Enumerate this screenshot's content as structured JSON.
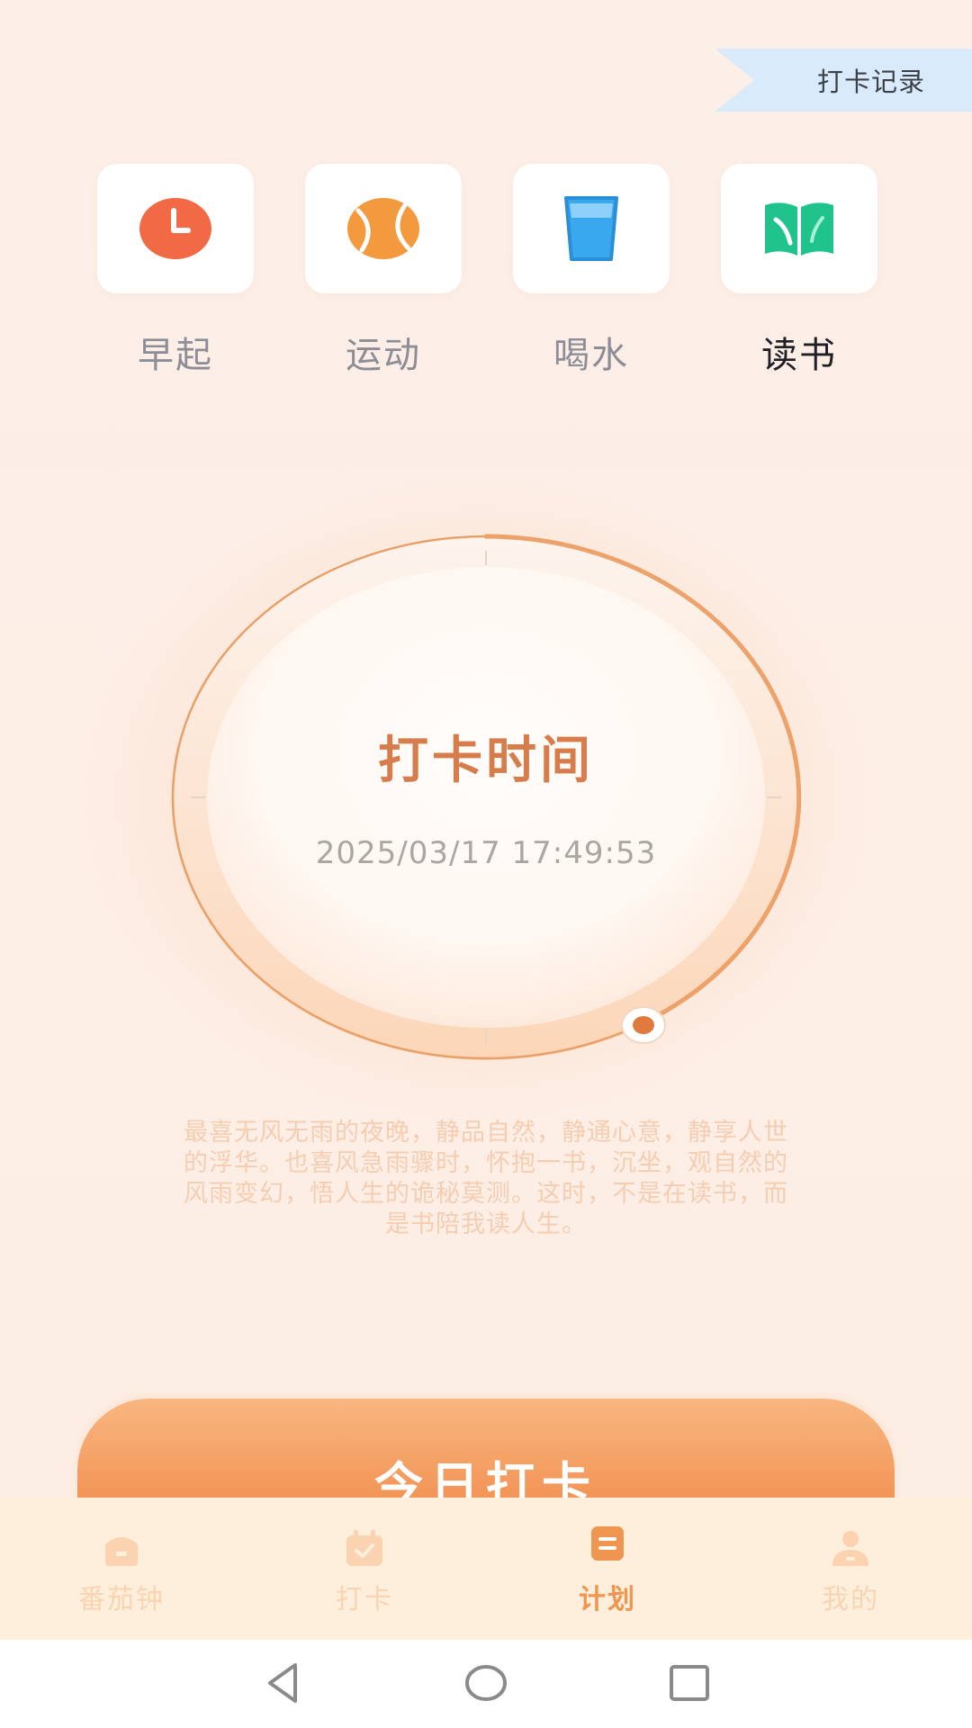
{
  "header": {
    "record_label": "打卡记录"
  },
  "categories": [
    {
      "label": "早起",
      "icon": "alarm-clock-icon",
      "color": "#f26a45"
    },
    {
      "label": "运动",
      "icon": "tennis-ball-icon",
      "color": "#f39a3f"
    },
    {
      "label": "喝水",
      "icon": "water-glass-icon",
      "color": "#3aa8ee"
    },
    {
      "label": "读书",
      "icon": "open-book-icon",
      "color": "#1fc38b",
      "selected": true
    }
  ],
  "dial": {
    "title": "打卡时间",
    "datetime": "2025/03/17 17:49:53"
  },
  "quote": [
    "最喜无风无雨的夜晚，静品自然，静通心意，静享人世",
    "的浮华。也喜风急雨骤时，怀抱一书，沉坐，观自然的",
    "风雨变幻，悟人生的诡秘莫测。这时，不是在读书，而",
    "是书陪我读人生。"
  ],
  "checkin_button": {
    "label": "今日打卡"
  },
  "tabs": [
    {
      "label": "番茄钟",
      "icon": "home-icon"
    },
    {
      "label": "打卡",
      "icon": "calendar-check-icon"
    },
    {
      "label": "计划",
      "icon": "list-icon",
      "active": true
    },
    {
      "label": "我的",
      "icon": "user-icon"
    }
  ],
  "colors": {
    "accent": "#f0954f",
    "title_orange": "#d67d4b",
    "ring": "#e8a068",
    "background": "#fdeee4"
  }
}
